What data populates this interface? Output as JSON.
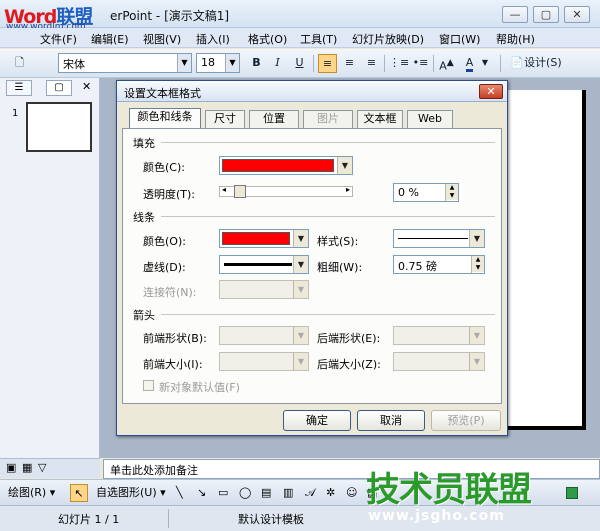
{
  "window": {
    "logo_a": "Word",
    "logo_b": "联盟",
    "logo_url": "www.wordlm.com",
    "title": "erPoint - [演示文稿1]",
    "min": "—",
    "max": "▢",
    "close": "✕"
  },
  "menu": [
    "文件(F)",
    "编辑(E)",
    "视图(V)",
    "插入(I)",
    "格式(O)",
    "工具(T)",
    "幻灯片放映(D)",
    "窗口(W)",
    "帮助(H)"
  ],
  "toolbar": {
    "font": "宋体",
    "size": "18",
    "bold": "B",
    "italic": "I",
    "underline": "U",
    "design": "设计(S)"
  },
  "pane": {
    "slide_number": "1"
  },
  "notes_placeholder": "单击此处添加备注",
  "draw_toolbar": {
    "draw": "绘图(R)",
    "autoshapes": "自选图形(U)"
  },
  "status": {
    "slide": "幻灯片 1 / 1",
    "template": "默认设计模板"
  },
  "watermark": {
    "text": "技术员联盟",
    "url": "www.jsgho.com"
  },
  "dialog": {
    "title": "设置文本框格式",
    "close": "✕",
    "tabs": [
      {
        "label": "颜色和线条",
        "selected": true,
        "disabled": false
      },
      {
        "label": "尺寸",
        "selected": false,
        "disabled": false
      },
      {
        "label": "位置",
        "selected": false,
        "disabled": false
      },
      {
        "label": "图片",
        "selected": false,
        "disabled": true
      },
      {
        "label": "文本框",
        "selected": false,
        "disabled": false
      },
      {
        "label": "Web",
        "selected": false,
        "disabled": false
      }
    ],
    "fill": {
      "section": "填充",
      "color_label": "颜色(C):",
      "color": "#ff0000",
      "transparency_label": "透明度(T):",
      "transparency": "0 %",
      "transparency_value": 0
    },
    "line": {
      "section": "线条",
      "color_label": "颜色(O):",
      "color": "#ff0000",
      "style_label": "样式(S):",
      "dash_label": "虚线(D):",
      "weight_label": "粗细(W):",
      "weight": "0.75 磅",
      "connector_label": "连接符(N):"
    },
    "arrows": {
      "section": "箭头",
      "begin_style": "前端形状(B):",
      "end_style": "后端形状(E):",
      "begin_size": "前端大小(I):",
      "end_size": "后端大小(Z):"
    },
    "default_checkbox": "新对象默认值(F)",
    "ok": "确定",
    "cancel": "取消",
    "preview": "预览(P)"
  }
}
